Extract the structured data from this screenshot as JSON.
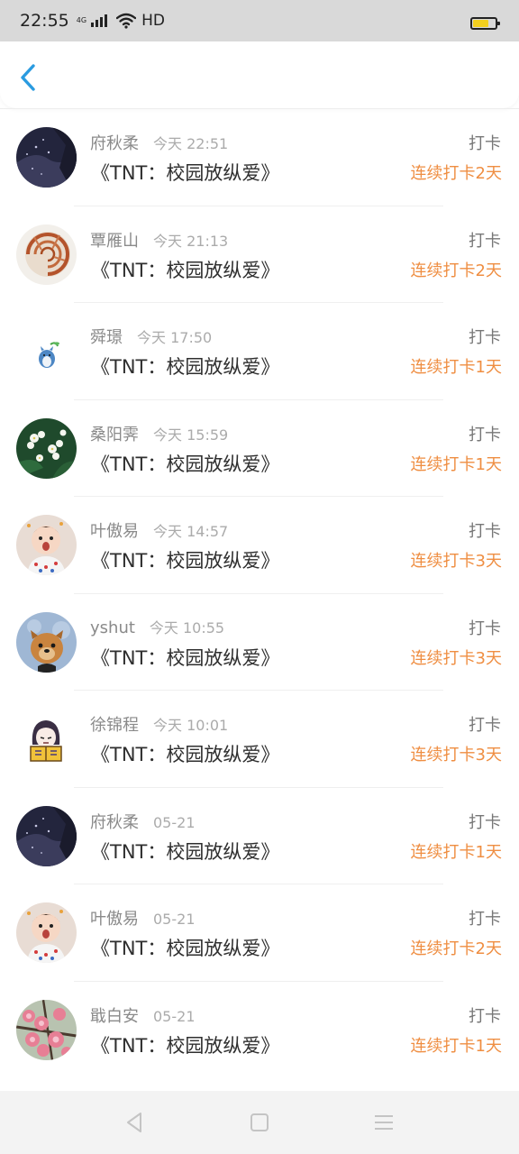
{
  "status": {
    "time": "22:55",
    "network": "4G",
    "hd": "HD",
    "battery_color": "#f2cf1f"
  },
  "header": {
    "back_icon": "chevron-left-icon",
    "accent": "#2a9be0"
  },
  "action_label": "打卡",
  "colors": {
    "streak": "#ef8e42",
    "name": "#8a8a8a",
    "title": "#2f2f2f"
  },
  "checkins": [
    {
      "name": "府秋柔",
      "time": "今天 22:51",
      "title": "《TNT：校园放纵爱》",
      "streak": "连续打卡2天",
      "avatar": "dark-night-avatar"
    },
    {
      "name": "覃雁山",
      "time": "今天 21:13",
      "title": "《TNT：校园放纵爱》",
      "streak": "连续打卡2天",
      "avatar": "nautilus-shell-avatar"
    },
    {
      "name": "舜璟",
      "time": "今天 17:50",
      "title": "《TNT：校园放纵爱》",
      "streak": "连续打卡1天",
      "avatar": "totoro-avatar"
    },
    {
      "name": "桑阳霁",
      "time": "今天 15:59",
      "title": "《TNT：校园放纵爱》",
      "streak": "连续打卡1天",
      "avatar": "white-flowers-avatar"
    },
    {
      "name": "叶傲易",
      "time": "今天 14:57",
      "title": "《TNT：校园放纵爱》",
      "streak": "连续打卡3天",
      "avatar": "baby-avatar"
    },
    {
      "name": "yshut",
      "time": "今天 10:55",
      "title": "《TNT：校园放纵爱》",
      "streak": "连续打卡3天",
      "avatar": "puppy-avatar"
    },
    {
      "name": "徐锦程",
      "time": "今天 10:01",
      "title": "《TNT：校园放纵爱》",
      "streak": "连续打卡3天",
      "avatar": "cartoon-reader-avatar"
    },
    {
      "name": "府秋柔",
      "time": "05-21",
      "title": "《TNT：校园放纵爱》",
      "streak": "连续打卡1天",
      "avatar": "dark-night-avatar"
    },
    {
      "name": "叶傲易",
      "time": "05-21",
      "title": "《TNT：校园放纵爱》",
      "streak": "连续打卡2天",
      "avatar": "baby-avatar"
    },
    {
      "name": "戢白安",
      "time": "05-21",
      "title": "《TNT：校园放纵爱》",
      "streak": "连续打卡1天",
      "avatar": "peach-blossom-avatar"
    }
  ],
  "nav": {
    "back": "triangle-back-icon",
    "home": "square-home-icon",
    "menu": "menu-lines-icon"
  }
}
